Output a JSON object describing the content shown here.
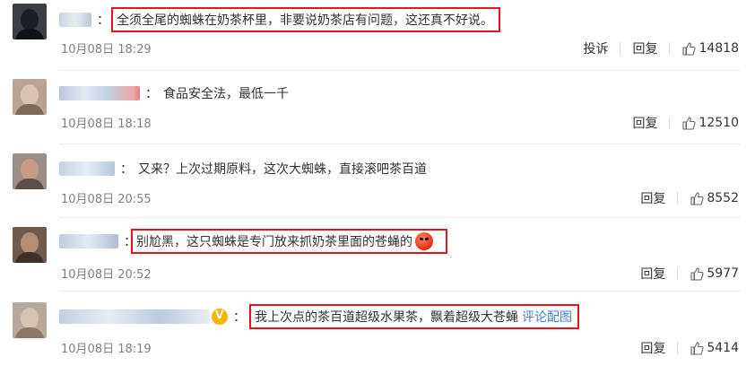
{
  "comments": [
    {
      "text": "全须全尾的蜘蛛在奶茶杯里，非要说奶茶店有问题，这还真不好说。",
      "colon": "：",
      "time": "10月08日 18:29",
      "report": "投诉",
      "reply": "回复",
      "likes": "14818",
      "highlighted": true
    },
    {
      "text": "食品安全法，最低一千",
      "colon": "：",
      "time": "10月08日 18:18",
      "reply": "回复",
      "likes": "12510",
      "highlighted": false
    },
    {
      "text": "又来？上次过期原料，这次大蜘蛛，直接滚吧茶百道",
      "colon": "：",
      "time": "10月08日 20:55",
      "reply": "回复",
      "likes": "8552",
      "highlighted": false
    },
    {
      "text": "别尬黑，这只蜘蛛是专门放来抓奶茶里面的苍蝇的",
      "colon": "：",
      "time": "10月08日 20:52",
      "reply": "回复",
      "likes": "5977",
      "highlighted": true,
      "emoji": "angry-face-emoji"
    },
    {
      "text": "我上次点的茶百道超级水果茶，飘着超级大苍蝇",
      "link": "评论配图",
      "colon": "：",
      "time": "10月08日 18:19",
      "reply": "回复",
      "likes": "5414",
      "highlighted": true,
      "badge": "vip-badge-icon"
    }
  ],
  "colors": {
    "highlight_border": "#e8141c",
    "link": "#3f7fd6",
    "time": "#808080",
    "text": "#333333"
  }
}
